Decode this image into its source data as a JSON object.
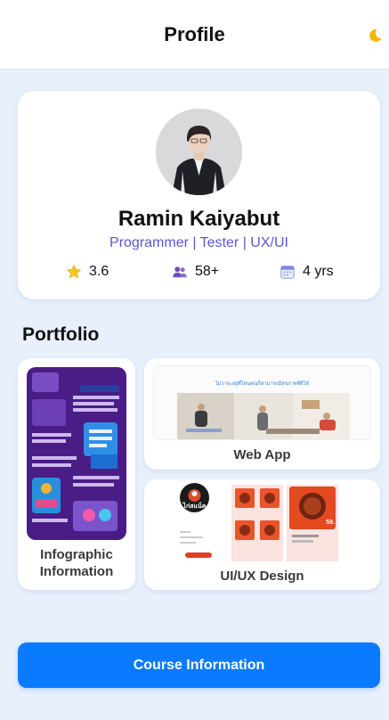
{
  "header": {
    "title": "Profile",
    "theme_icon": "moon-icon"
  },
  "profile": {
    "name": "Ramin Kaiyabut",
    "roles": "Programmer | Tester | UX/UI",
    "stats": [
      {
        "icon": "star-icon",
        "value": "3.6"
      },
      {
        "icon": "people-icon",
        "value": "58+"
      },
      {
        "icon": "calendar-icon",
        "value": "4 yrs"
      }
    ]
  },
  "portfolio": {
    "title": "Portfolio",
    "items": [
      {
        "label": "Infographic Information"
      },
      {
        "label": "Web App",
        "banner_text": "ไม่ว่าจะอยู่ที่ไหนคุณก็สามารถมีสุขภาพที่ดีได้"
      },
      {
        "label": "UI/UX Design",
        "logo_text": "ไก่สแน็ค",
        "price": "59."
      }
    ]
  },
  "cta": {
    "label": "Course Information"
  },
  "colors": {
    "accent": "#0a7bff",
    "role_text": "#5b57d6",
    "background": "#e8f0fc"
  }
}
